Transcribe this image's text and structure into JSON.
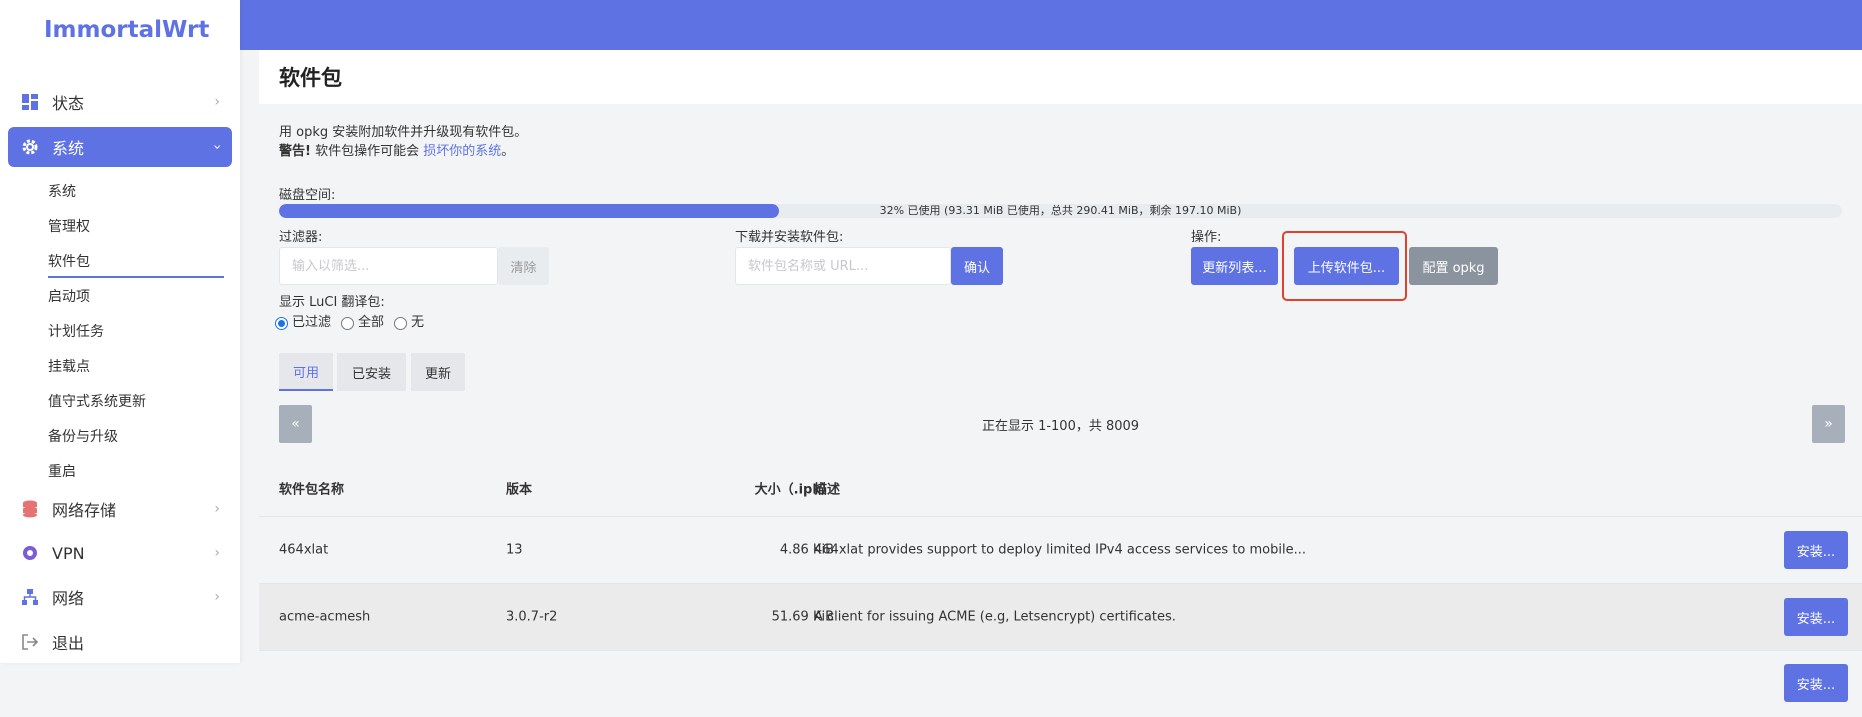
{
  "brand": "ImmortalWrt",
  "sidebar": {
    "items": [
      {
        "label": "状态",
        "icon": "dashboard-icon"
      },
      {
        "label": "系统",
        "icon": "gear-icon",
        "active": true
      },
      {
        "label": "网络存储",
        "icon": "database-icon"
      },
      {
        "label": "VPN",
        "icon": "vpn-icon"
      },
      {
        "label": "网络",
        "icon": "network-icon"
      },
      {
        "label": "退出",
        "icon": "logout-icon"
      }
    ],
    "submenu": [
      "系统",
      "管理权",
      "软件包",
      "启动项",
      "计划任务",
      "挂载点",
      "值守式系统更新",
      "备份与升级",
      "重启"
    ],
    "submenu_current": "软件包"
  },
  "page": {
    "title": "软件包",
    "intro": "用 opkg 安装附加软件并升级现有软件包。",
    "warning_bold": "警告!",
    "warning_text": " 软件包操作可能会 ",
    "warning_link": "损坏你的系统",
    "warning_end": "。"
  },
  "disk": {
    "label": "磁盘空间:",
    "used_percent": 32,
    "text": "32% 已使用 (93.31 MiB 已使用，总共 290.41 MiB，剩余 197.10 MiB)"
  },
  "filter": {
    "label": "过滤器:",
    "placeholder": "输入以筛选...",
    "clear": "清除"
  },
  "download": {
    "label": "下载并安装软件包:",
    "placeholder": "软件包名称或 URL...",
    "confirm": "确认"
  },
  "actions": {
    "label": "操作:",
    "update_lists": "更新列表...",
    "upload": "上传软件包...",
    "configure": "配置 opkg"
  },
  "translations": {
    "label": "显示 LuCI 翻译包:",
    "options": [
      "已过滤",
      "全部",
      "无"
    ],
    "selected": "已过滤"
  },
  "tabs": [
    "可用",
    "已安装",
    "更新"
  ],
  "active_tab": "可用",
  "pager": {
    "prev": "«",
    "next": "»",
    "status": "正在显示 1-100，共 8009"
  },
  "table": {
    "headers": [
      "软件包名称",
      "版本",
      "大小（.ipk）",
      "描述"
    ],
    "rows": [
      {
        "name": "464xlat",
        "version": "13",
        "size": "4.86 KiB",
        "desc": "464xlat provides support to deploy limited IPv4 access services to mobile...",
        "action": "安装..."
      },
      {
        "name": "acme-acmesh",
        "version": "3.0.7-r2",
        "size": "51.69 KiB",
        "desc": "A client for issuing ACME (e.g, Letsencrypt) certificates.",
        "action": "安装..."
      },
      {
        "name": "",
        "version": "",
        "size": "",
        "desc": "",
        "action": "安装..."
      }
    ]
  },
  "colors": {
    "accent": "#5e72e4",
    "highlight": "#e0402c"
  }
}
